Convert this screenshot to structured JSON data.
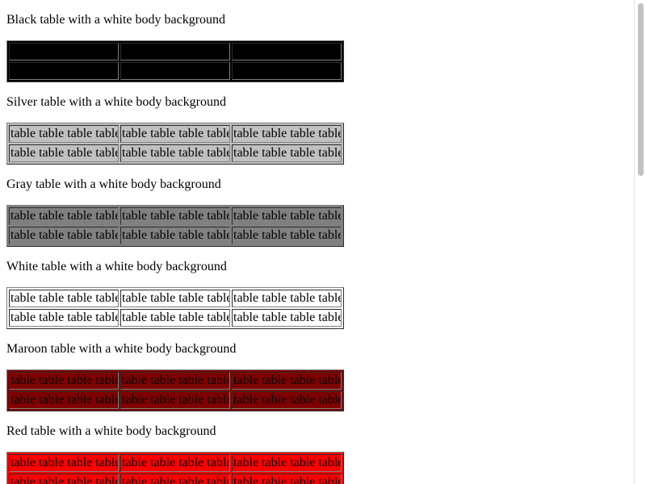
{
  "sections": [
    {
      "title": "Black table with a white body background",
      "bg": "#000000",
      "rows": [
        [
          "",
          "",
          ""
        ],
        [
          "",
          "",
          ""
        ]
      ]
    },
    {
      "title": "Silver table with a white body background",
      "bg": "#c0c0c0",
      "rows": [
        [
          "table table table table",
          "table table table table",
          "table table table table"
        ],
        [
          "table table table table",
          "table table table table",
          "table table table table"
        ]
      ]
    },
    {
      "title": "Gray table with a white body background",
      "bg": "#808080",
      "rows": [
        [
          "table table table table",
          "table table table table",
          "table table table table"
        ],
        [
          "table table table table",
          "table table table table",
          "table table table table"
        ]
      ]
    },
    {
      "title": "White table with a white body background",
      "bg": "#ffffff",
      "rows": [
        [
          "table table table table",
          "table table table table",
          "table table table table"
        ],
        [
          "table table table table",
          "table table table table",
          "table table table table"
        ]
      ]
    },
    {
      "title": "Maroon table with a white body background",
      "bg": "#800000",
      "rows": [
        [
          "table table table table",
          "table table table table",
          "table table table table"
        ],
        [
          "table table table table",
          "table table table table",
          "table table table table"
        ]
      ]
    },
    {
      "title": "Red table with a white body background",
      "bg": "#ff0000",
      "rows": [
        [
          "table table table table",
          "table table table table",
          "table table table table"
        ],
        [
          "table table table table",
          "table table table table",
          "table table table table"
        ]
      ]
    }
  ]
}
